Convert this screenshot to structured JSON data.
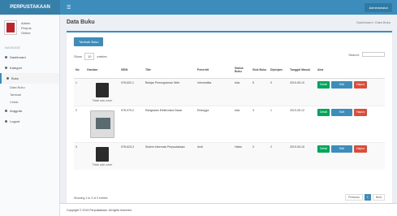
{
  "app": {
    "logo": "PERPUSTAKAAN",
    "user_menu": "Administrator"
  },
  "sidebar": {
    "user": {
      "name": "Admin",
      "line2": "Perpus",
      "status": "Online"
    },
    "header": "NAVIGASI",
    "items": [
      {
        "label": "Dashboard"
      },
      {
        "label": "Kategori"
      },
      {
        "label": "Buku"
      },
      {
        "label": "Data Buku"
      },
      {
        "label": "Tambah"
      },
      {
        "label": "Cetak"
      },
      {
        "label": "Anggota"
      },
      {
        "label": "Logout"
      }
    ]
  },
  "page": {
    "title": "Data Buku",
    "breadcrumb": "Dashboard › Data Buku"
  },
  "toolbar": {
    "add_label": "Tambah Buku"
  },
  "table_controls": {
    "show_label": "Show",
    "entries_value": "10",
    "entries_label": "entries",
    "search_label": "Search:"
  },
  "table": {
    "headers": [
      "No",
      "Gambar",
      "ISBN",
      "Title",
      "Penerbit",
      "Status Buku",
      "Stok Buku",
      "Dipinjam",
      "Tanggal Masuk",
      "Aksi"
    ],
    "rows": [
      {
        "no": "1",
        "caption": "Tidak ada cover",
        "isbn": "978-602-1",
        "title": "Belajar Pemrograman Web",
        "penerbit": "Informatika",
        "status": "Ada",
        "stok": "5",
        "dipinjam": "0",
        "tanggal": "2019-05-10"
      },
      {
        "no": "2",
        "caption": "",
        "isbn": "978-979-2",
        "title": "Rangkaian Elektronika Dasar",
        "penerbit": "Erlangga",
        "status": "Ada",
        "stok": "3",
        "dipinjam": "1",
        "tanggal": "2019-05-12"
      },
      {
        "no": "3",
        "caption": "Tidak ada cover",
        "isbn": "978-623-3",
        "title": "Sistem Informasi Perpustakaan",
        "penerbit": "Andi",
        "status": "Habis",
        "stok": "0",
        "dipinjam": "2",
        "tanggal": "2019-05-15"
      }
    ],
    "actions": {
      "detail": "Detail",
      "edit": "Edit",
      "delete": "Hapus"
    }
  },
  "table_footer": {
    "info": "Showing 1 to 3 of 3 entries",
    "prev": "Previous",
    "page": "1",
    "next": "Next"
  },
  "footer": {
    "text": "Copyright © 2019 Perpustakaan. All rights reserved."
  }
}
